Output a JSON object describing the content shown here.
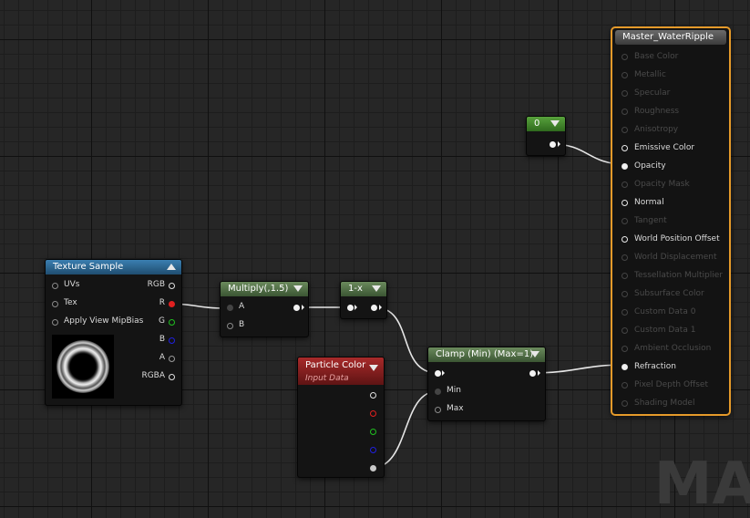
{
  "watermark": "MA",
  "texture_sample": {
    "title": "Texture Sample",
    "inputs": [
      "UVs",
      "Tex",
      "Apply View MipBias"
    ],
    "outputs": [
      "RGB",
      "R",
      "G",
      "B",
      "A",
      "RGBA"
    ]
  },
  "multiply": {
    "title": "Multiply(,1.5)",
    "inputs": [
      "A",
      "B"
    ]
  },
  "one_minus": {
    "title": "1-x"
  },
  "constant": {
    "title": "0"
  },
  "particle_color": {
    "title": "Particle Color",
    "subtitle": "Input Data"
  },
  "clamp": {
    "title": "Clamp (Min) (Max=1)",
    "inputs": [
      "Min",
      "Max"
    ]
  },
  "master": {
    "title": "Master_WaterRipple",
    "pins": [
      {
        "label": "Base Color",
        "active": false
      },
      {
        "label": "Metallic",
        "active": false
      },
      {
        "label": "Specular",
        "active": false
      },
      {
        "label": "Roughness",
        "active": false
      },
      {
        "label": "Anisotropy",
        "active": false
      },
      {
        "label": "Emissive Color",
        "active": true
      },
      {
        "label": "Opacity",
        "active": true
      },
      {
        "label": "Opacity Mask",
        "active": false
      },
      {
        "label": "Normal",
        "active": true
      },
      {
        "label": "Tangent",
        "active": false
      },
      {
        "label": "World Position Offset",
        "active": true
      },
      {
        "label": "World Displacement",
        "active": false
      },
      {
        "label": "Tessellation Multiplier",
        "active": false
      },
      {
        "label": "Subsurface Color",
        "active": false
      },
      {
        "label": "Custom Data 0",
        "active": false
      },
      {
        "label": "Custom Data 1",
        "active": false
      },
      {
        "label": "Ambient Occlusion",
        "active": false
      },
      {
        "label": "Refraction",
        "active": true
      },
      {
        "label": "Pixel Depth Offset",
        "active": false
      },
      {
        "label": "Shading Model",
        "active": false
      }
    ]
  },
  "colors": {
    "texture_header": "#2a5f86",
    "math_header": "#4d6b42",
    "constant_header": "#3d7a2a",
    "particle_header": "#8a1f1f",
    "master_border": "#e59a2a",
    "pin_red": "#e02020",
    "pin_green": "#20c020",
    "pin_blue": "#2020e0"
  }
}
